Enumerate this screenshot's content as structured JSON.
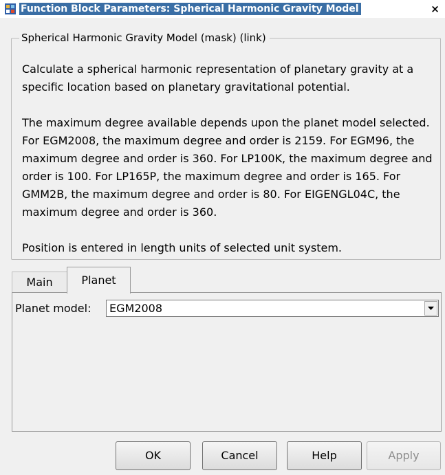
{
  "window": {
    "title": "Function Block Parameters: Spherical Harmonic Gravity Model",
    "close_glyph": "×"
  },
  "group": {
    "legend": "Spherical Harmonic Gravity Model (mask) (link)",
    "paragraphs": [
      "Calculate a spherical harmonic representation of planetary gravity at a specific location based on planetary gravitational potential.",
      "The maximum degree available depends upon the planet model selected.  For EGM2008, the maximum degree and order is 2159.  For EGM96, the maximum degree and order is 360.  For LP100K, the maximum degree and order is 100.  For LP165P, the maximum degree and order is 165.  For GMM2B, the maximum degree and order is 80.  For EIGENGL04C, the maximum degree and order is 360.",
      "Position is entered in length units of selected unit system."
    ]
  },
  "tabs": [
    {
      "label": "Main",
      "selected": false
    },
    {
      "label": "Planet",
      "selected": true
    }
  ],
  "planet_tab": {
    "planet_model_label": "Planet model:",
    "planet_model_value": "EGM2008"
  },
  "buttons": {
    "ok": "OK",
    "cancel": "Cancel",
    "help": "Help",
    "apply": "Apply"
  },
  "icons": {
    "app": "simulink-block-icon",
    "close": "close-icon",
    "dropdown": "chevron-down-icon"
  },
  "colors": {
    "title_highlight": "#3a6ea5",
    "dialog_bg": "#f0f0f0"
  }
}
